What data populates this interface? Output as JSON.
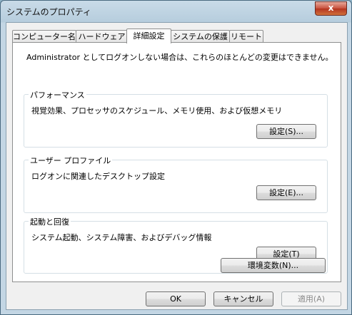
{
  "window": {
    "title": "システムのプロパティ",
    "close_glyph": "x"
  },
  "tabs": [
    {
      "label": "コンピューター名"
    },
    {
      "label": "ハードウェア"
    },
    {
      "label": "詳細設定",
      "active": true
    },
    {
      "label": "システムの保護"
    },
    {
      "label": "リモート"
    }
  ],
  "panel": {
    "note": "Administrator としてログオンしない場合は、これらのほとんどの変更はできません。",
    "performance": {
      "label": "パフォーマンス",
      "desc": "視覚効果、プロセッサのスケジュール、メモリ使用、および仮想メモリ",
      "button": "設定(S)..."
    },
    "user_profile": {
      "label": "ユーザー プロファイル",
      "desc": "ログオンに関連したデスクトップ設定",
      "button": "設定(E)..."
    },
    "startup": {
      "label": "起動と回復",
      "desc": "システム起動、システム障害、およびデバッグ情報",
      "button": "設定(T)"
    },
    "env_button": "環境変数(N)..."
  },
  "footer": {
    "ok": "OK",
    "cancel": "キャンセル",
    "apply": "適用(A)"
  }
}
